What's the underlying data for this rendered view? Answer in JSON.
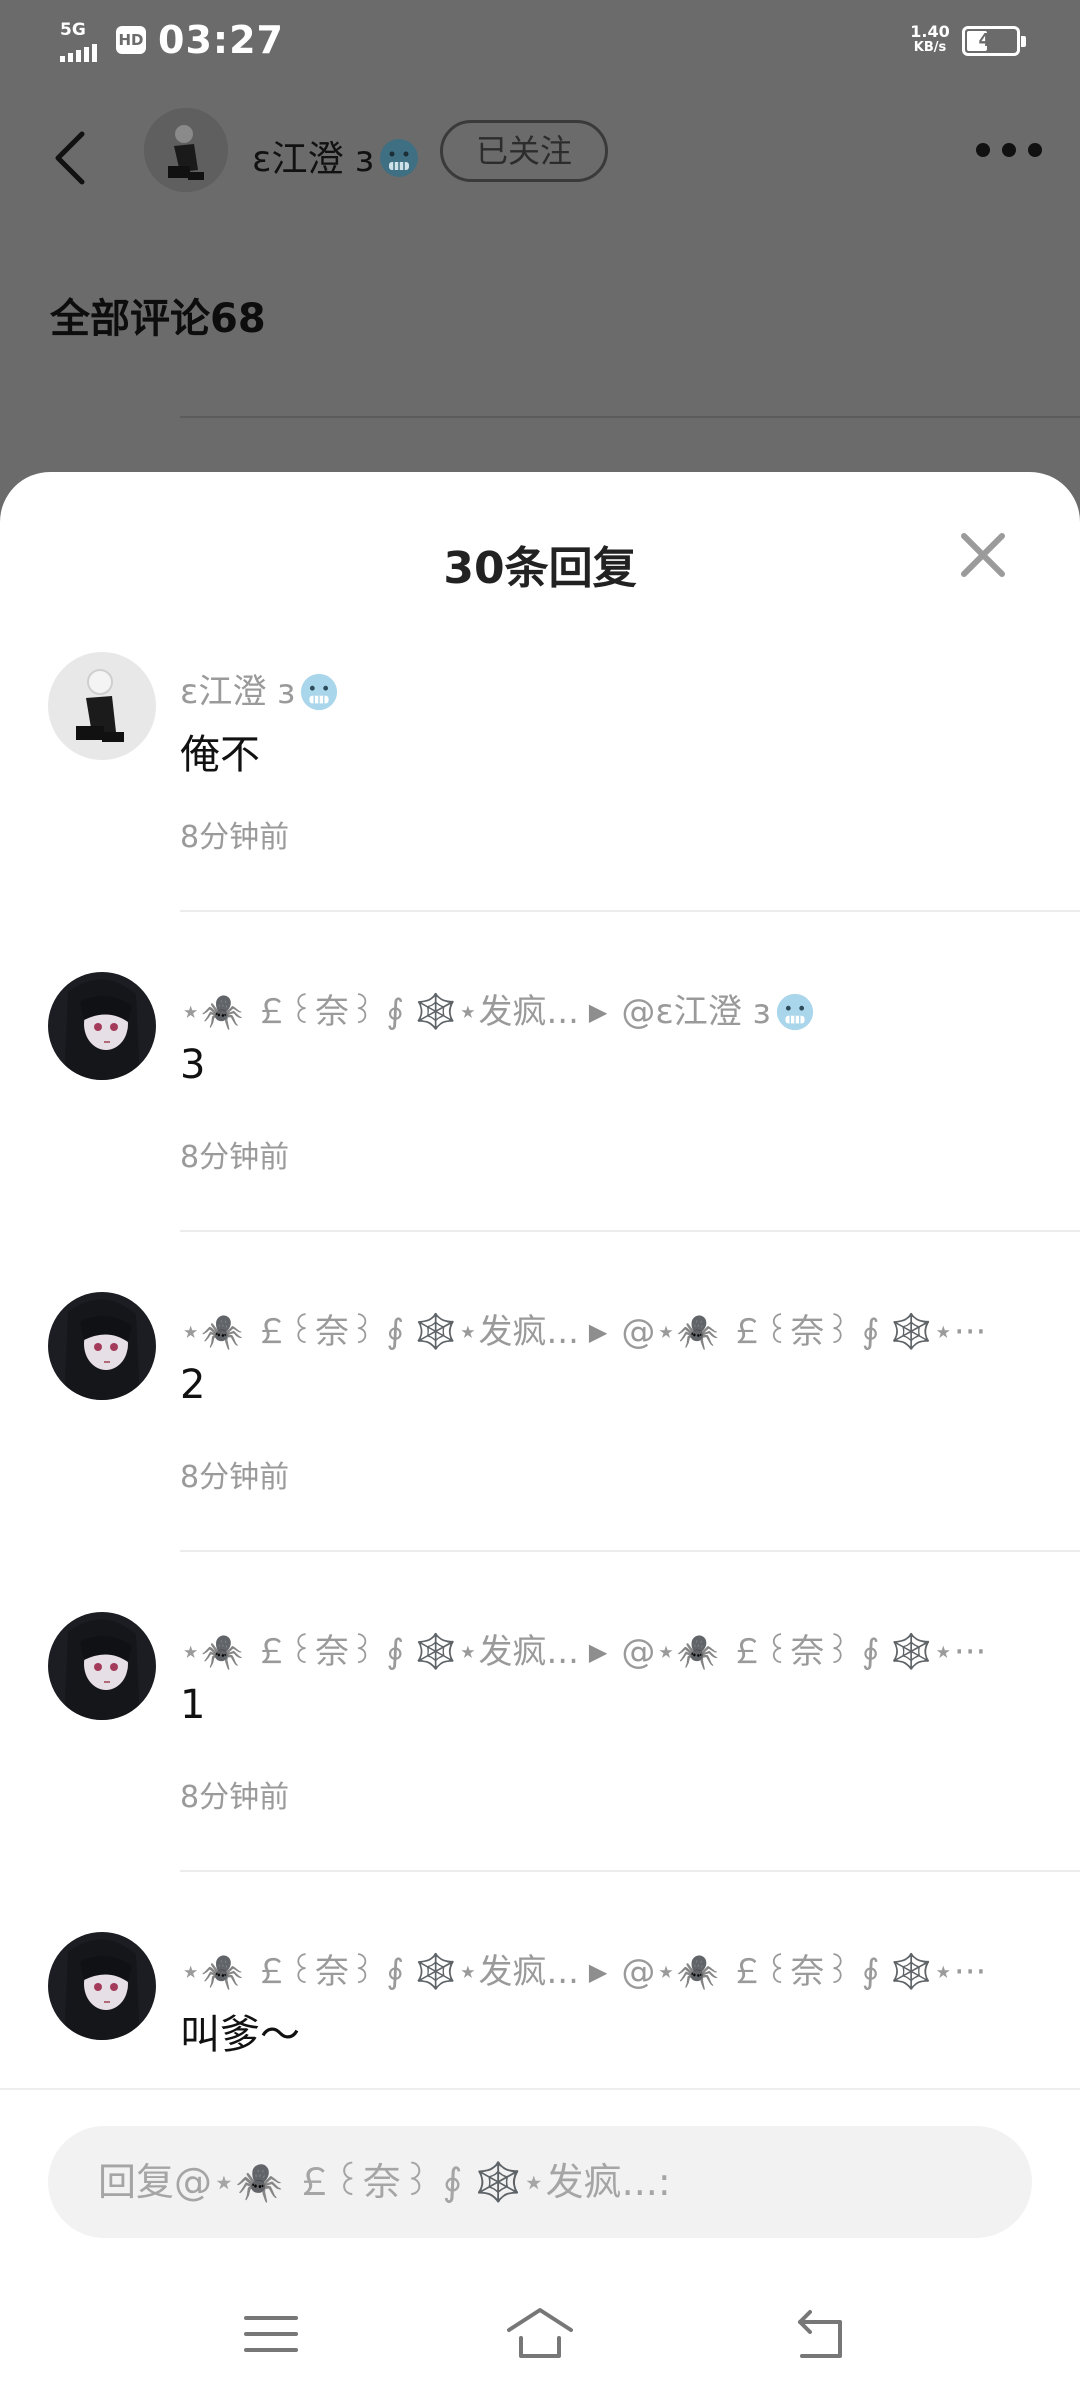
{
  "status_bar": {
    "network": "5G",
    "hd": "HD",
    "time": "03:27",
    "speed_value": "1.40",
    "speed_unit": "KB/s",
    "battery": "46",
    "battery_level": 0.46
  },
  "header": {
    "username": "ɛ江澄 з",
    "username_emoji": "cold-face-emoji",
    "follow_label": "已关注"
  },
  "background": {
    "comments_title": "全部评论68"
  },
  "sheet": {
    "title": "30条回复"
  },
  "replies": [
    {
      "user": "ɛ江澄 з",
      "reply_to": "",
      "reply_to_emoji": false,
      "user_emoji": true,
      "content": "俺不",
      "time": "8分钟前",
      "avatar": "avatar-figure-white-hair"
    },
    {
      "user": "⋆🕷️ ￡꒰奈꒱ ∮ 🕸️⋆发疯...",
      "reply_to": "@ɛ江澄 з",
      "reply_to_emoji": true,
      "user_emoji": false,
      "content": "3",
      "time": "8分钟前",
      "avatar": "avatar-anime-dark-hair"
    },
    {
      "user": "⋆🕷️ ￡꒰奈꒱ ∮ 🕸️⋆发疯...",
      "reply_to": "@⋆🕷️ ￡꒰奈꒱ ∮ 🕸️⋆···",
      "reply_to_emoji": false,
      "user_emoji": false,
      "content": "2",
      "time": "8分钟前",
      "avatar": "avatar-anime-dark-hair"
    },
    {
      "user": "⋆🕷️ ￡꒰奈꒱ ∮ 🕸️⋆发疯...",
      "reply_to": "@⋆🕷️ ￡꒰奈꒱ ∮ 🕸️⋆···",
      "reply_to_emoji": false,
      "user_emoji": false,
      "content": "1",
      "time": "8分钟前",
      "avatar": "avatar-anime-dark-hair"
    },
    {
      "user": "⋆🕷️ ￡꒰奈꒱ ∮ 🕸️⋆发疯...",
      "reply_to": "@⋆🕷️ ￡꒰奈꒱ ∮ 🕸️⋆···",
      "reply_to_emoji": false,
      "user_emoji": false,
      "content": "叫爹～",
      "time": "",
      "avatar": "avatar-anime-dark-hair"
    }
  ],
  "input": {
    "placeholder": "回复@⋆🕷️ ￡꒰奈꒱ ∮ 🕸️⋆发疯...:"
  },
  "icons": {
    "back": "back-arrow-icon",
    "more": "more-icon",
    "close": "close-icon",
    "reply_arrow": "▶",
    "sys_menu": "menu-icon",
    "sys_home": "home-icon",
    "sys_back": "back-icon"
  },
  "colors": {
    "overlay": "#6b6b6b",
    "sheet": "#ffffff",
    "secondary_text": "#9a9a9a",
    "divider": "#ececec",
    "input_bg": "#f2f2f2"
  }
}
